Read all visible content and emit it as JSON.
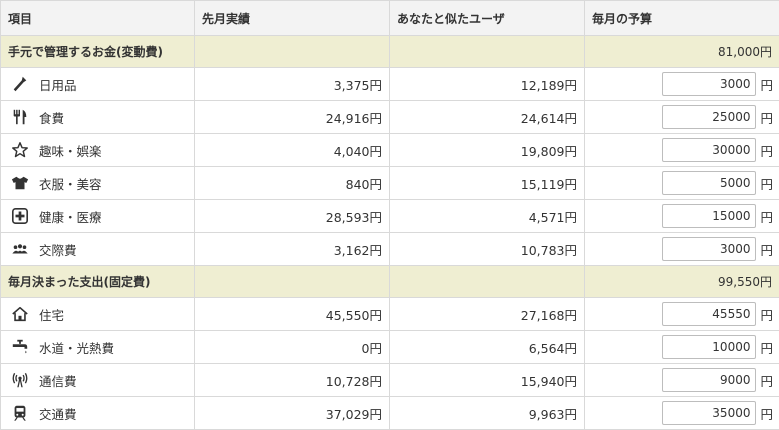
{
  "headers": [
    "項目",
    "先月実績",
    "あなたと似たユーザ",
    "毎月の予算"
  ],
  "unit": "円",
  "sections": [
    {
      "title": "手元で管理するお金(変動費)",
      "total": "81,000円",
      "items": [
        {
          "icon": "tool-icon",
          "label": "日用品",
          "last_month": "3,375円",
          "similar": "12,189円",
          "budget": "3000"
        },
        {
          "icon": "fork-knife-icon",
          "label": "食費",
          "last_month": "24,916円",
          "similar": "24,614円",
          "budget": "25000"
        },
        {
          "icon": "star-icon",
          "label": "趣味・娯楽",
          "last_month": "4,040円",
          "similar": "19,809円",
          "budget": "30000"
        },
        {
          "icon": "shirt-icon",
          "label": "衣服・美容",
          "last_month": "840円",
          "similar": "15,119円",
          "budget": "5000"
        },
        {
          "icon": "medical-cross-icon",
          "label": "健康・医療",
          "last_month": "28,593円",
          "similar": "4,571円",
          "budget": "15000"
        },
        {
          "icon": "people-icon",
          "label": "交際費",
          "last_month": "3,162円",
          "similar": "10,783円",
          "budget": "3000"
        }
      ]
    },
    {
      "title": "毎月決まった支出(固定費)",
      "total": "99,550円",
      "items": [
        {
          "icon": "house-icon",
          "label": "住宅",
          "last_month": "45,550円",
          "similar": "27,168円",
          "budget": "45550"
        },
        {
          "icon": "faucet-icon",
          "label": "水道・光熱費",
          "last_month": "0円",
          "similar": "6,564円",
          "budget": "10000"
        },
        {
          "icon": "antenna-icon",
          "label": "通信費",
          "last_month": "10,728円",
          "similar": "15,940円",
          "budget": "9000"
        },
        {
          "icon": "train-icon",
          "label": "交通費",
          "last_month": "37,029円",
          "similar": "9,963円",
          "budget": "35000"
        }
      ]
    }
  ]
}
